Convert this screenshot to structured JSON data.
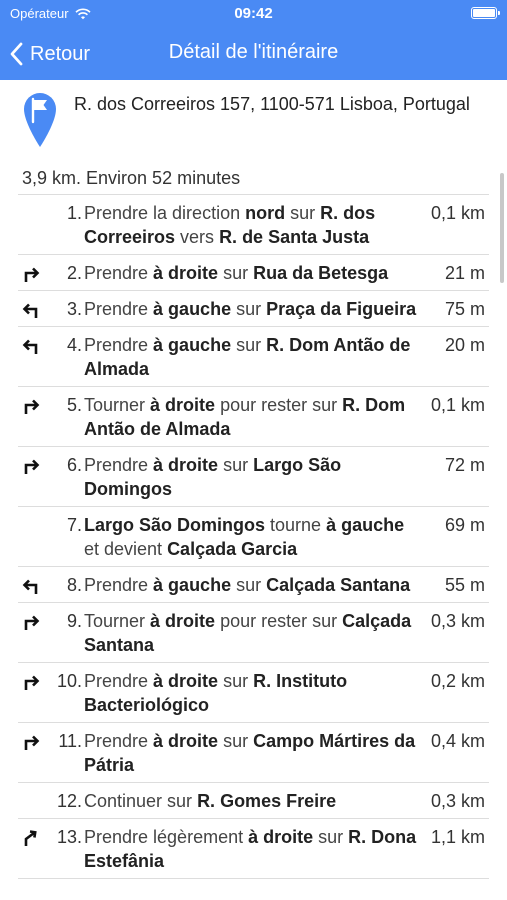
{
  "status_bar": {
    "carrier": "Opérateur",
    "time": "09:42"
  },
  "nav": {
    "back_label": "Retour",
    "title": "Détail de l'itinéraire"
  },
  "colors": {
    "accent": "#4a8af4",
    "divider": "#dddddd"
  },
  "destination": {
    "address": "R. dos Correeiros 157, 1100-571 Lisboa, Portugal",
    "icon": "flag-pin-icon"
  },
  "summary": "3,9 km. Environ 52 minutes",
  "steps": [
    {
      "num": "1.",
      "icon": "",
      "dist": "0,1 km",
      "parts": [
        [
          "Prendre la direction ",
          false
        ],
        [
          "nord",
          true
        ],
        [
          " sur ",
          false
        ],
        [
          "R. dos Correeiros",
          true
        ],
        [
          " vers ",
          false
        ],
        [
          "R. de Santa Justa",
          true
        ]
      ]
    },
    {
      "num": "2.",
      "icon": "turn-right",
      "dist": "21 m",
      "parts": [
        [
          "Prendre ",
          false
        ],
        [
          "à droite",
          true
        ],
        [
          " sur ",
          false
        ],
        [
          "Rua da Betesga",
          true
        ]
      ]
    },
    {
      "num": "3.",
      "icon": "turn-left",
      "dist": "75 m",
      "parts": [
        [
          "Prendre ",
          false
        ],
        [
          "à gauche",
          true
        ],
        [
          " sur ",
          false
        ],
        [
          "Praça da Figueira",
          true
        ]
      ]
    },
    {
      "num": "4.",
      "icon": "turn-left",
      "dist": "20 m",
      "parts": [
        [
          "Prendre ",
          false
        ],
        [
          "à gauche",
          true
        ],
        [
          " sur ",
          false
        ],
        [
          "R. Dom Antão de Almada",
          true
        ]
      ]
    },
    {
      "num": "5.",
      "icon": "turn-right",
      "dist": "0,1 km",
      "parts": [
        [
          "Tourner ",
          false
        ],
        [
          "à droite",
          true
        ],
        [
          " pour rester sur ",
          false
        ],
        [
          "R. Dom Antão de Almada",
          true
        ]
      ]
    },
    {
      "num": "6.",
      "icon": "turn-right",
      "dist": "72 m",
      "parts": [
        [
          "Prendre ",
          false
        ],
        [
          "à droite",
          true
        ],
        [
          " sur ",
          false
        ],
        [
          "Largo São Domingos",
          true
        ]
      ]
    },
    {
      "num": "7.",
      "icon": "",
      "dist": "69 m",
      "parts": [
        [
          "Largo São Domingos",
          true
        ],
        [
          " tourne ",
          false
        ],
        [
          "à gauche",
          true
        ],
        [
          " et devient ",
          false
        ],
        [
          "Calçada Garcia",
          true
        ]
      ]
    },
    {
      "num": "8.",
      "icon": "turn-left",
      "dist": "55 m",
      "parts": [
        [
          "Prendre ",
          false
        ],
        [
          "à gauche",
          true
        ],
        [
          " sur ",
          false
        ],
        [
          "Calçada Santana",
          true
        ]
      ]
    },
    {
      "num": "9.",
      "icon": "turn-right",
      "dist": "0,3 km",
      "parts": [
        [
          "Tourner ",
          false
        ],
        [
          "à droite",
          true
        ],
        [
          " pour rester sur ",
          false
        ],
        [
          "Calçada Santana",
          true
        ]
      ]
    },
    {
      "num": "10.",
      "icon": "turn-right",
      "dist": "0,2 km",
      "parts": [
        [
          "Prendre ",
          false
        ],
        [
          "à droite",
          true
        ],
        [
          " sur ",
          false
        ],
        [
          "R. Instituto Bacteriológico",
          true
        ]
      ]
    },
    {
      "num": "11.",
      "icon": "turn-right",
      "dist": "0,4 km",
      "parts": [
        [
          "Prendre ",
          false
        ],
        [
          "à droite",
          true
        ],
        [
          " sur ",
          false
        ],
        [
          "Campo Mártires da Pátria",
          true
        ]
      ]
    },
    {
      "num": "12.",
      "icon": "",
      "dist": "0,3 km",
      "parts": [
        [
          "Continuer sur ",
          false
        ],
        [
          "R. Gomes Freire",
          true
        ]
      ]
    },
    {
      "num": "13.",
      "icon": "turn-slight-right",
      "dist": "1,1 km",
      "parts": [
        [
          "Prendre légèrement ",
          false
        ],
        [
          "à droite",
          true
        ],
        [
          " sur ",
          false
        ],
        [
          "R. Dona Estefânia",
          true
        ]
      ]
    }
  ]
}
